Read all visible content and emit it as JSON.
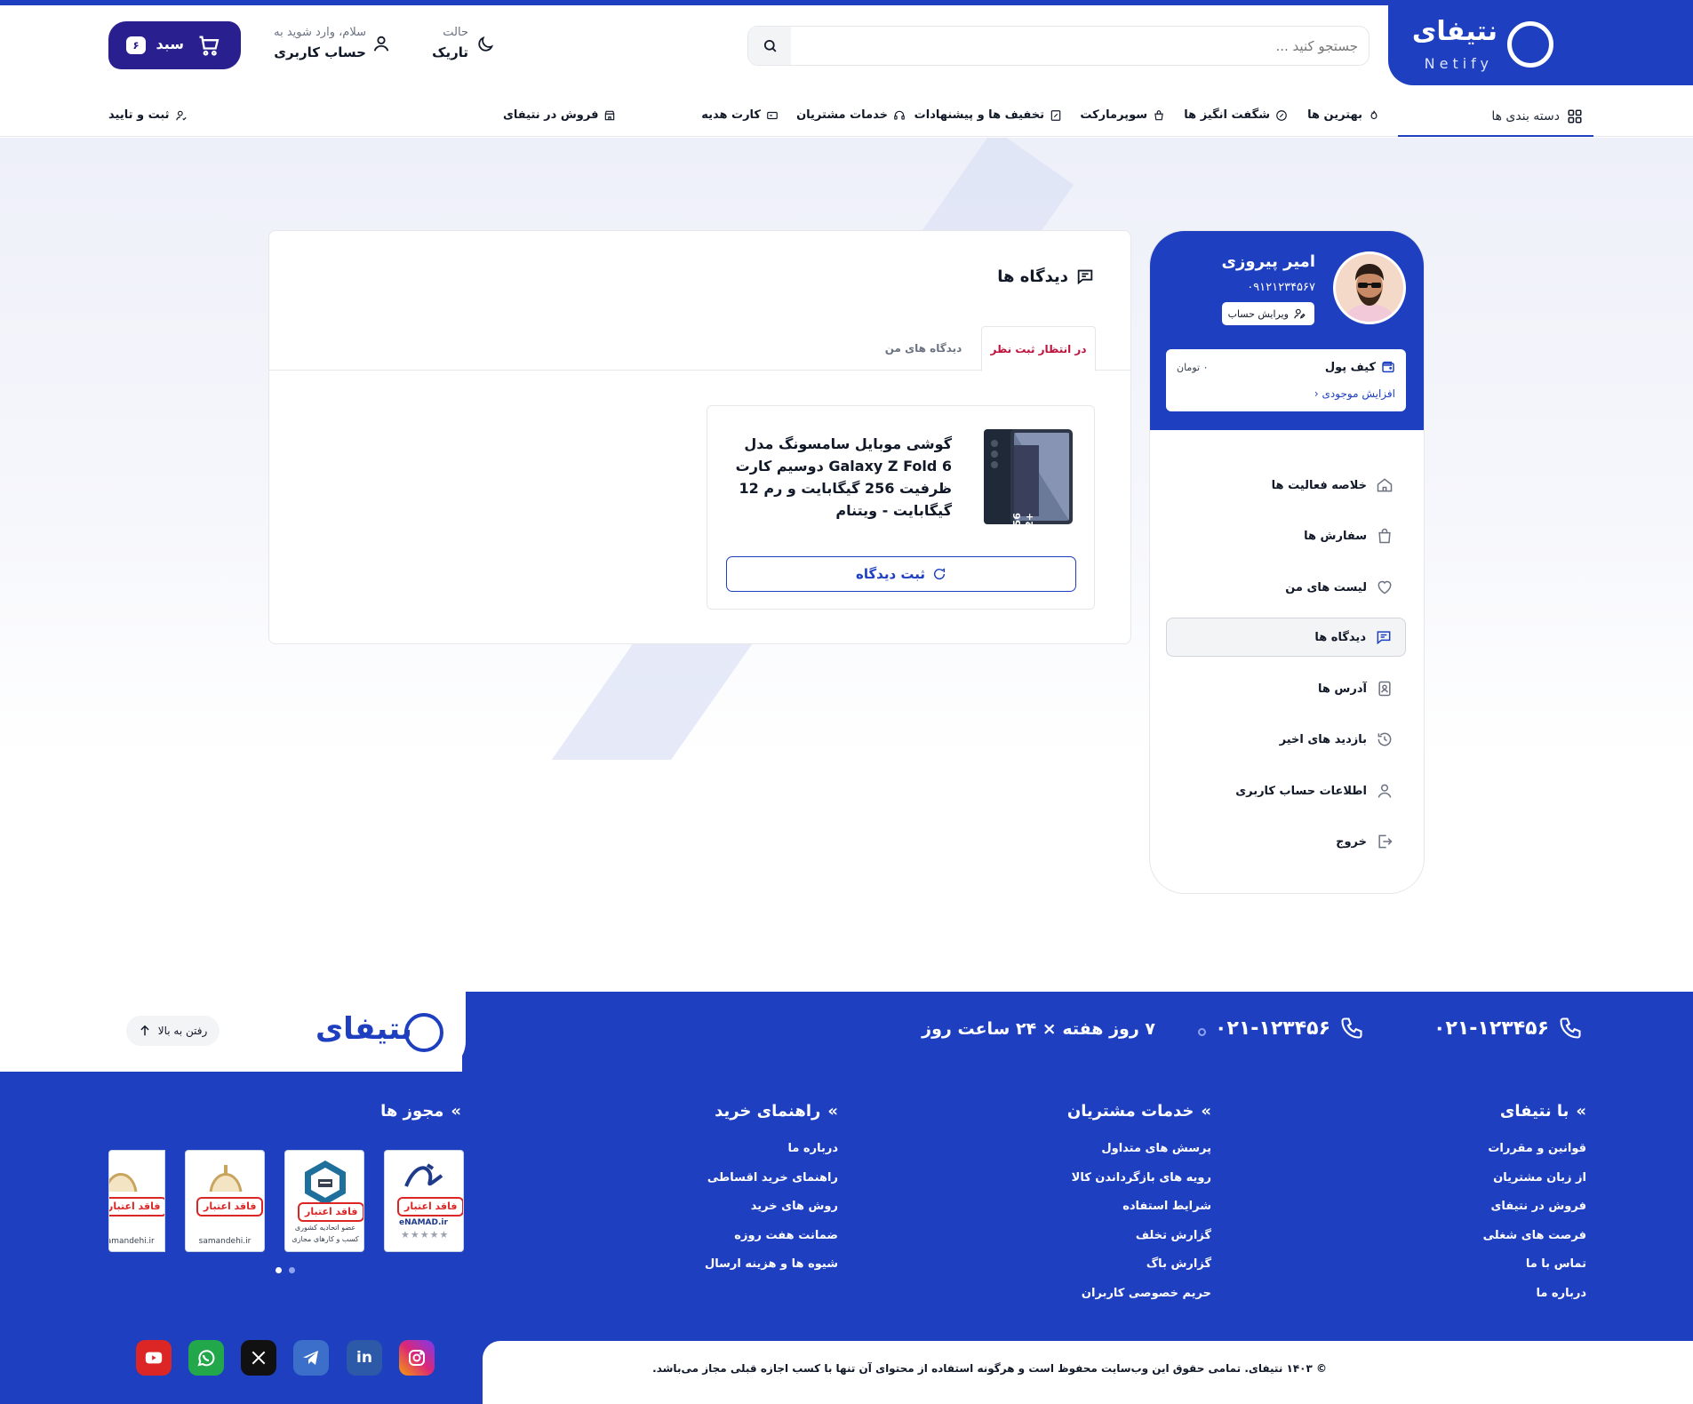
{
  "header": {
    "logo_fa": "نتیفای",
    "logo_en": "Netify",
    "search_placeholder": "جستجو کنید ...",
    "theme_label": "حالت",
    "theme_value": "تاریک",
    "account_greeting": "سلام، وارد شوید به",
    "account_label": "حساب کاربری",
    "cart_label": "سبد",
    "cart_count": "۶"
  },
  "nav": {
    "categories": "دسته بندی ها",
    "items": [
      "بهترین ها",
      "شگفت انگیز ها",
      "سوپرمارکت",
      "تخفیف ها و پیشنهادات",
      "خدمات مشتریان",
      "کارت هدیه"
    ],
    "sell": "فروش در نتیفای",
    "register": "ثبت و تایید"
  },
  "sidebar": {
    "user_name": "امیر پیروزی",
    "user_phone": "۰۹۱۲۱۲۳۴۵۶۷",
    "edit_account": "ویرایش حساب",
    "wallet_title": "کیف پول",
    "wallet_amount": "۰ تومان",
    "wallet_increase": "افزایش موجودی",
    "menu": [
      "خلاصه فعالیت ها",
      "سفارش ها",
      "لیست های من",
      "دیدگاه ها",
      "آدرس ها",
      "بازدید های اخیر",
      "اطلاعات حساب کاربری",
      "خروج"
    ]
  },
  "content": {
    "title": "دیدگاه ها",
    "tab_pending": "در انتظار ثبت نظر",
    "tab_mine": "دیدگاه های من",
    "product_title": "گوشی موبایل سامسونگ مدل Galaxy Z Fold 6 دوسیم کارت ظرفیت 256 گیگابایت و رم 12 گیگابایت - ویتنام",
    "submit_review": "ثبت دیدگاه"
  },
  "footer": {
    "phone1": "۰۲۱-۱۲۳۴۵۶",
    "phone2": "۰۲۱-۱۲۳۴۵۶",
    "hours": "۷ روز هفته × ۲۴ ساعت روز",
    "logo_fa": "نتیفای",
    "to_top": "رفتن به بالا",
    "col1_title": "با نتیفای",
    "col1": [
      "قوانین و مقررات",
      "از زبان مشتریان",
      "فروش در نتیفای",
      "فرصت های شغلی",
      "تماس با ما",
      "درباره ما"
    ],
    "col2_title": "خدمات مشتریان",
    "col2": [
      "پرسش های متداول",
      "رویه های بازگرداندن کالا",
      "شرایط استفاده",
      "گزارش تخلف",
      "گزارش باگ",
      "حریم خصوصی کاربران"
    ],
    "col3_title": "راهنمای خرید",
    "col3": [
      "درباره ما",
      "راهنمای خرید اقساطی",
      "روش های خرید",
      "ضمانت هفت روزه",
      "شیوه ها و هزینه ارسال"
    ],
    "col4_title": "مجوز ها",
    "badge_invalid": "فاقد اعتبار",
    "badge_enamad": "eNAMAD.ir",
    "badge_etehadieh": "عضو اتحادیه کشوری کسب و کارهای مجازی",
    "badge_samandehi": "samandehi.ir",
    "copyright": "© ۱۴۰۳ نتیفای. تمامی حقوق این وب‌سایت محفوظ است و هرگونه استفاده از محتوای آن تنها با کسب اجازه قبلی مجاز می‌باشد."
  },
  "colors": {
    "primary": "#1e3fbf",
    "cart": "#2a1f8f",
    "pending_tab": "#be123c"
  }
}
